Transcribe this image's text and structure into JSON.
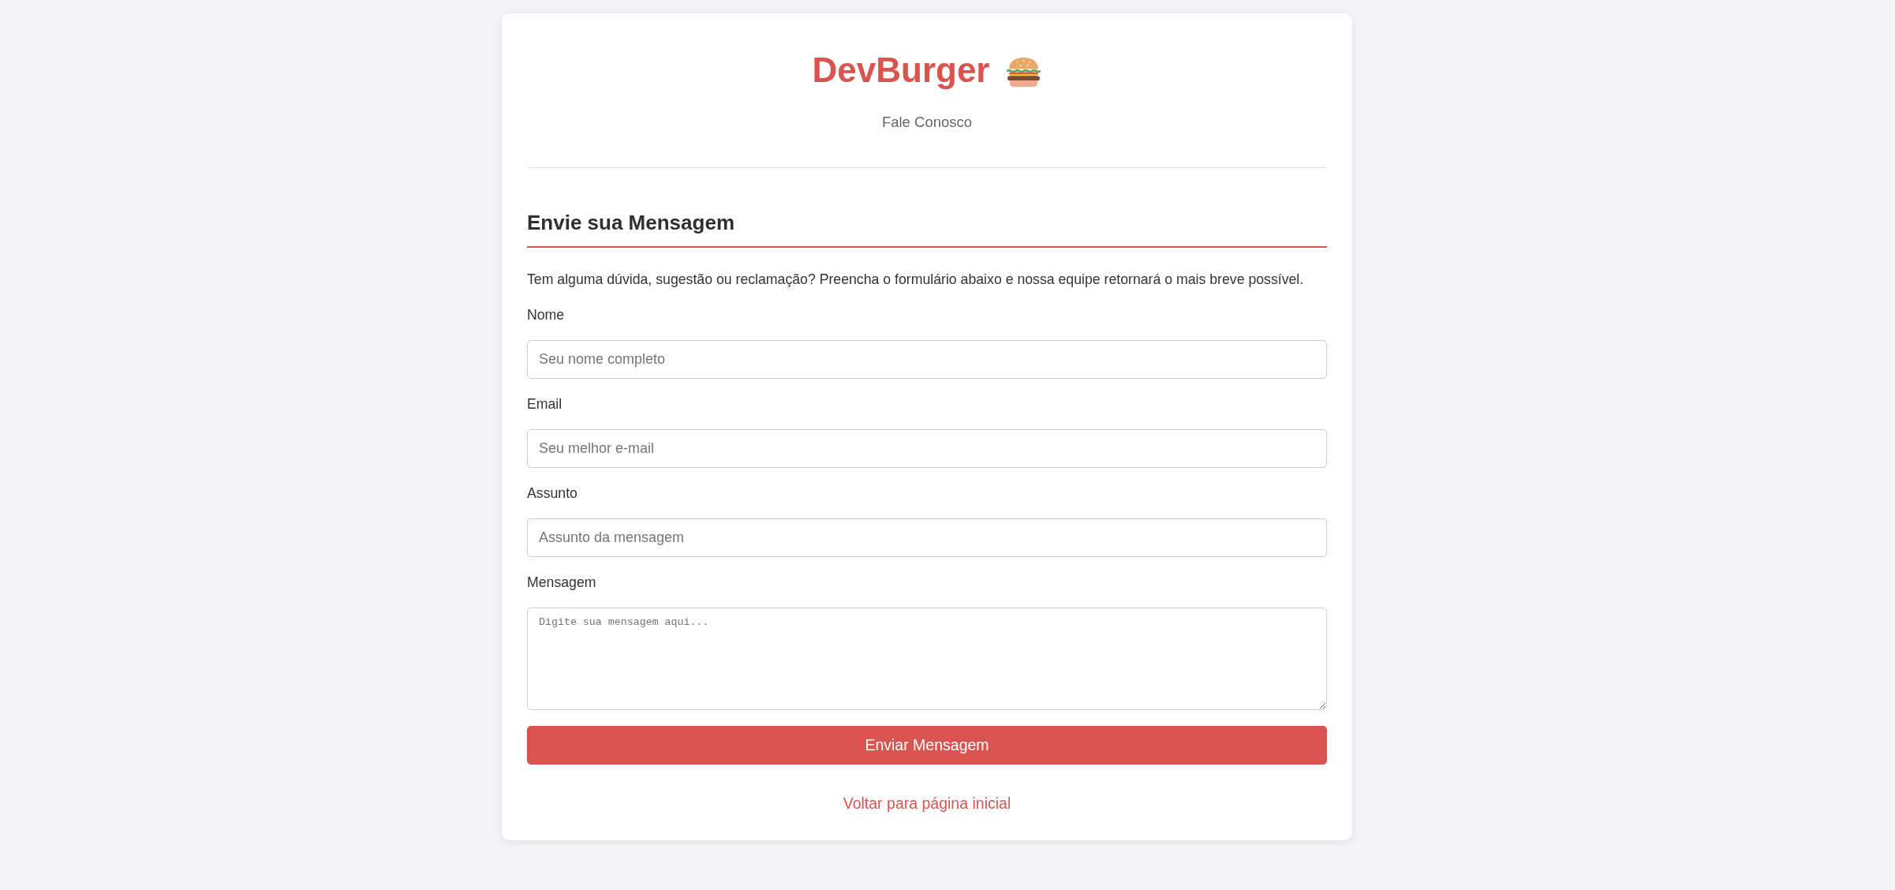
{
  "header": {
    "title": "DevBurger",
    "subtitle": "Fale Conosco"
  },
  "section": {
    "heading": "Envie sua Mensagem",
    "intro": "Tem alguma dúvida, sugestão ou reclamação? Preencha o formulário abaixo e nossa equipe retornará o mais breve possível."
  },
  "form": {
    "fields": [
      {
        "kind": "input",
        "label": "Nome",
        "placeholder": "Seu nome completo"
      },
      {
        "kind": "input",
        "label": "Email",
        "placeholder": "Seu melhor e-mail"
      },
      {
        "kind": "input",
        "label": "Assunto",
        "placeholder": "Assunto da mensagem"
      },
      {
        "kind": "textarea",
        "label": "Mensagem",
        "placeholder": "Digite sua mensagem aqui..."
      }
    ],
    "submit": "Enviar Mensagem"
  },
  "back_link": "Voltar para página inicial"
}
